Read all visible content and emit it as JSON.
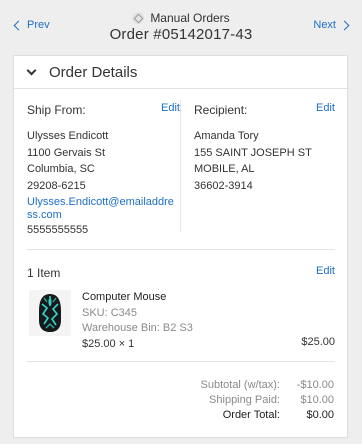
{
  "nav": {
    "prev_label": "Prev",
    "next_label": "Next",
    "app_title": "Manual Orders",
    "order_title": "Order #05142017-43"
  },
  "section": {
    "title": "Order Details"
  },
  "ship_from": {
    "heading": "Ship From:",
    "edit_label": "Edit",
    "name": "Ulysses Endicott",
    "street": "1100 Gervais St",
    "city_state": "Columbia, SC",
    "zip": "29208-6215",
    "email": "Ulysses.Endicott@emailaddress.com",
    "phone": "5555555555"
  },
  "recipient": {
    "heading": "Recipient:",
    "edit_label": "Edit",
    "name": "Amanda Tory",
    "street": "155 SAINT JOSEPH ST",
    "city_state": "MOBILE, AL",
    "zip": "36602-3914"
  },
  "items": {
    "heading": "1 Item",
    "edit_label": "Edit",
    "list": [
      {
        "name": "Computer Mouse",
        "sku": "SKU: C345",
        "bin": "Warehouse Bin: B2 S3",
        "price_qty": "$25.00 × 1",
        "total": "$25.00"
      }
    ]
  },
  "totals": {
    "subtotal_label": "Subtotal (w/tax):",
    "subtotal_value": "-$10.00",
    "shipping_label": "Shipping Paid:",
    "shipping_value": "$10.00",
    "order_total_label": "Order Total:",
    "order_total_value": "$0.00"
  },
  "colors": {
    "link": "#1e6fc8",
    "text": "#333333",
    "muted": "#8a8a8a",
    "background": "#eeeeee"
  },
  "icons": [
    "chevron-left-icon",
    "chevron-right-icon",
    "app-logo-icon",
    "chevron-down-icon",
    "mouse-product-image"
  ]
}
